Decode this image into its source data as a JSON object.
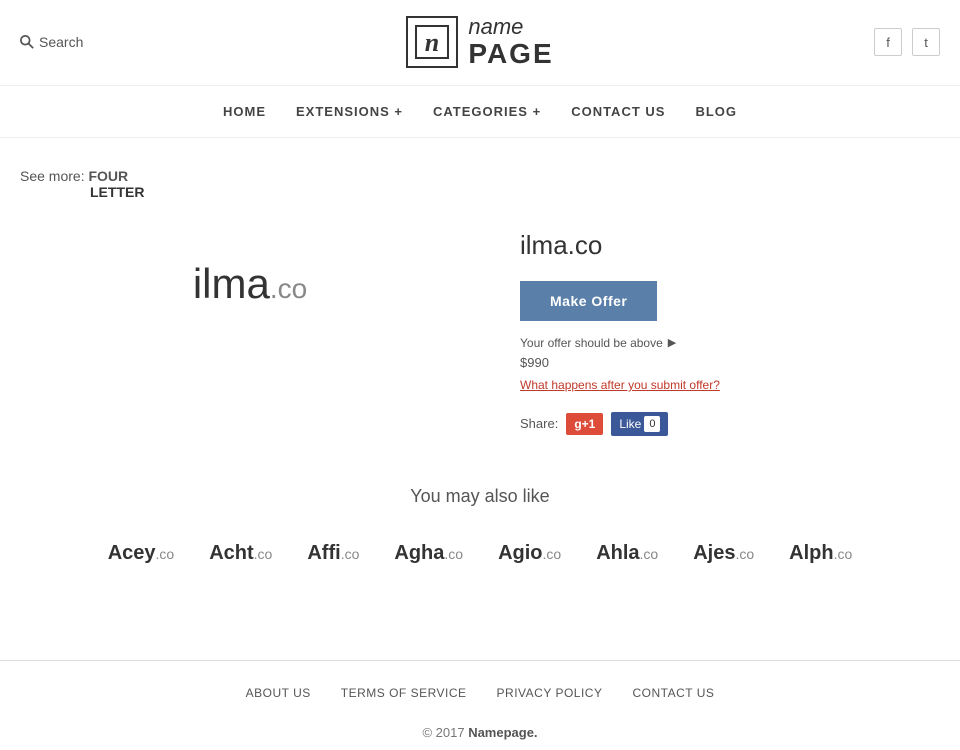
{
  "header": {
    "search_label": "Search",
    "logo_symbol": "n",
    "logo_name": "name",
    "logo_page": "PAGE",
    "facebook_icon": "f",
    "twitter_icon": "t"
  },
  "nav": {
    "items": [
      {
        "label": "HOME"
      },
      {
        "label": "EXTENSIONS +"
      },
      {
        "label": "CATEGORIES +"
      },
      {
        "label": "CONTACT US"
      },
      {
        "label": "BLOG"
      }
    ]
  },
  "breadcrumb": {
    "see_more_label": "See more:",
    "see_more_line1": "FOUR",
    "see_more_line2": "LETTER"
  },
  "domain": {
    "name": "ilma",
    "tld": ".co",
    "full": "ilma.co",
    "make_offer_label": "Make Offer",
    "offer_hint": "Your offer should be above",
    "offer_amount": "$990",
    "what_happens": "What happens after you submit offer?",
    "share_label": "Share:",
    "gplus_label": "g+1",
    "fb_like_label": "Like",
    "fb_count": "0"
  },
  "also_like": {
    "title": "You may also like",
    "domains": [
      {
        "name": "Acey",
        "tld": ".co"
      },
      {
        "name": "Acht",
        "tld": ".co"
      },
      {
        "name": "Affi",
        "tld": ".co"
      },
      {
        "name": "Agha",
        "tld": ".co"
      },
      {
        "name": "Agio",
        "tld": ".co"
      },
      {
        "name": "Ahla",
        "tld": ".co"
      },
      {
        "name": "Ajes",
        "tld": ".co"
      },
      {
        "name": "Alph",
        "tld": ".co"
      }
    ]
  },
  "footer": {
    "nav": [
      {
        "label": "ABOUT US"
      },
      {
        "label": "TERMS OF SERVICE"
      },
      {
        "label": "PRIVACY POLICY"
      },
      {
        "label": "CONTACT US"
      }
    ],
    "copyright": "© 2017",
    "brand": "Namepage."
  }
}
